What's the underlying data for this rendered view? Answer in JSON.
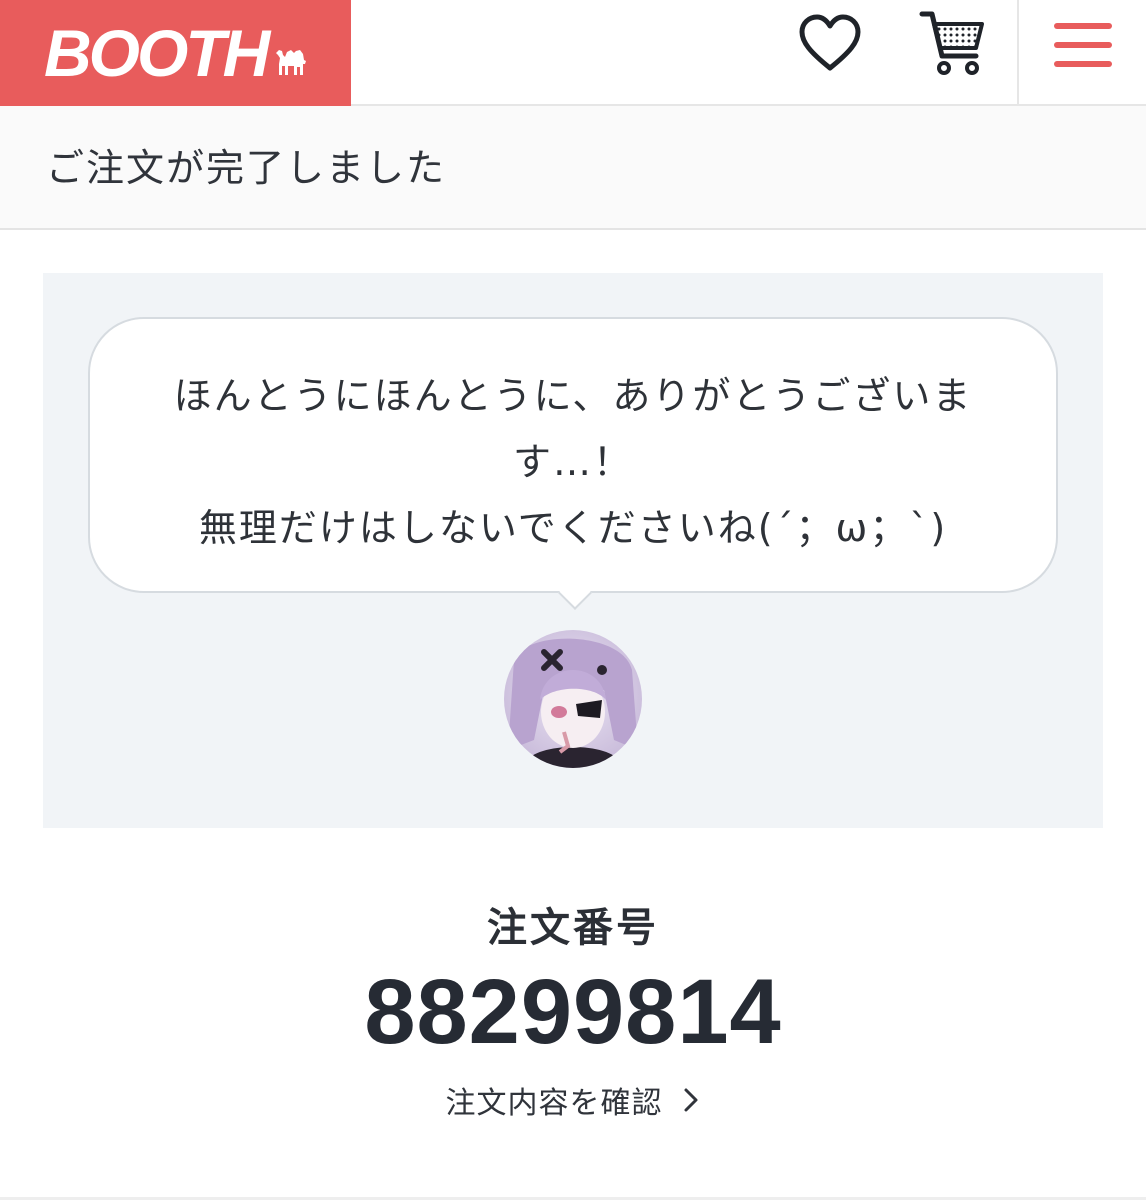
{
  "header": {
    "logo_text": "BOOTH",
    "logo_icon": "camel-icon",
    "favorites_icon": "heart-icon",
    "cart_icon": "cart-icon",
    "menu_icon": "hamburger-menu-icon",
    "brand_color": "#e85c5c"
  },
  "title_bar": {
    "title": "ご注文が完了しました"
  },
  "thanks": {
    "message": "ほんとうにほんとうに、ありがとうございます…！\n無理だけはしないでくださいね(´；ω；`)",
    "avatar_icon": "creator-avatar"
  },
  "order": {
    "label": "注文番号",
    "number": "88299814",
    "link_label": "注文内容を確認",
    "link_icon": "chevron-right-icon"
  }
}
